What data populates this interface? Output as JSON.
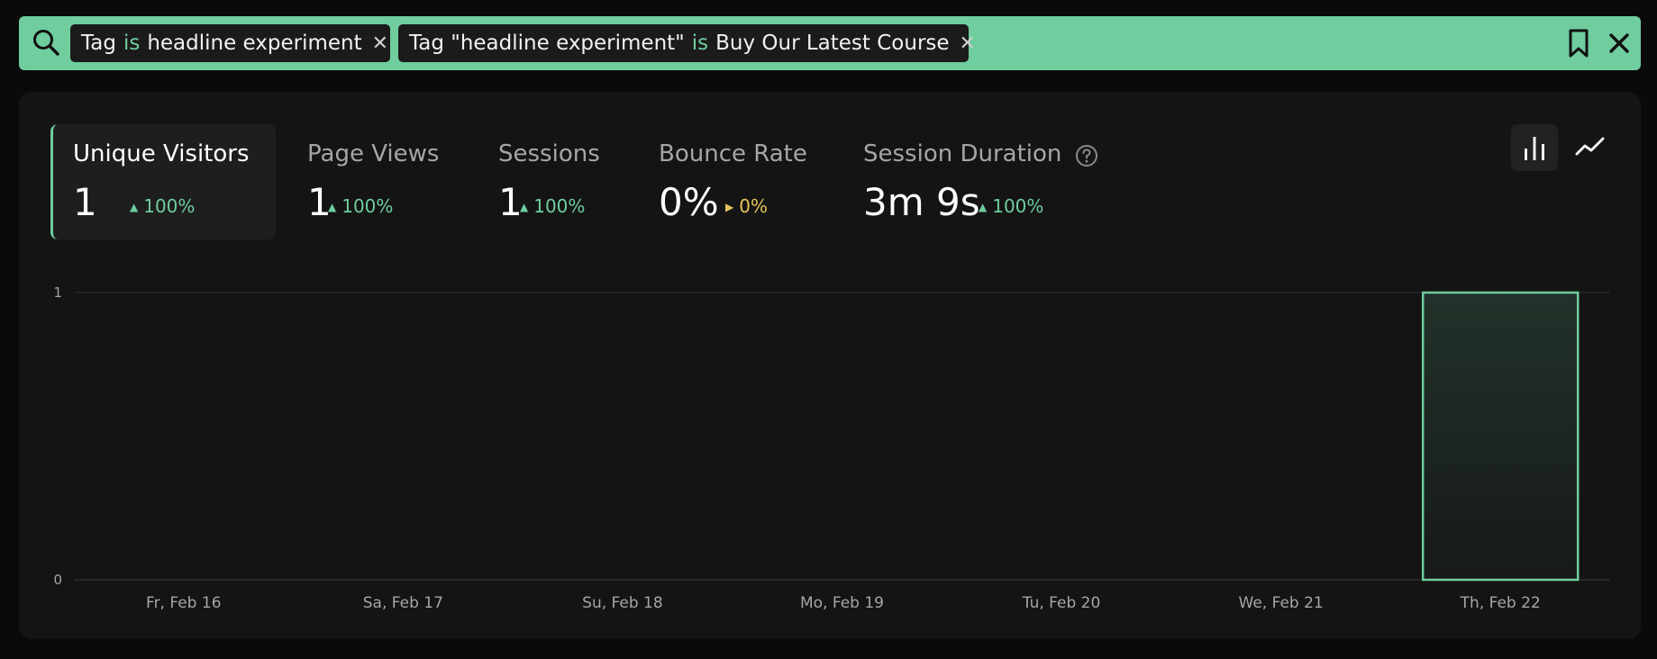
{
  "filters": [
    {
      "field": "Tag",
      "operator": "is",
      "value": "headline experiment"
    },
    {
      "field": "Tag \"headline experiment\"",
      "operator": "is",
      "value": "Buy Our Latest Course"
    }
  ],
  "metrics": [
    {
      "label": "Unique Visitors",
      "value": "1",
      "delta": "100%",
      "trend": "up",
      "active": true
    },
    {
      "label": "Page Views",
      "value": "1",
      "delta": "100%",
      "trend": "up",
      "active": false
    },
    {
      "label": "Sessions",
      "value": "1",
      "delta": "100%",
      "trend": "up",
      "active": false
    },
    {
      "label": "Bounce Rate",
      "value": "0%",
      "delta": "0%",
      "trend": "neutral",
      "active": false
    },
    {
      "label": "Session Duration",
      "value": "3m 9s",
      "delta": "100%",
      "trend": "up",
      "active": false
    }
  ],
  "colors": {
    "accent": "#6fcd9e",
    "neutral": "#e6c45a",
    "panel": "#141414",
    "background": "#0a0a0a"
  },
  "icons": [
    "search-icon",
    "bookmark-icon",
    "close-icon",
    "help-icon",
    "bar-chart-icon",
    "line-chart-icon"
  ],
  "chart_data": {
    "type": "bar",
    "categories": [
      "Fr, Feb 16",
      "Sa, Feb 17",
      "Su, Feb 18",
      "Mo, Feb 19",
      "Tu, Feb 20",
      "We, Feb 21",
      "Th, Feb 22"
    ],
    "values": [
      0,
      0,
      0,
      0,
      0,
      0,
      1
    ],
    "ylim": [
      0,
      1
    ],
    "yticks": [
      "0",
      "1"
    ],
    "grid": true
  }
}
